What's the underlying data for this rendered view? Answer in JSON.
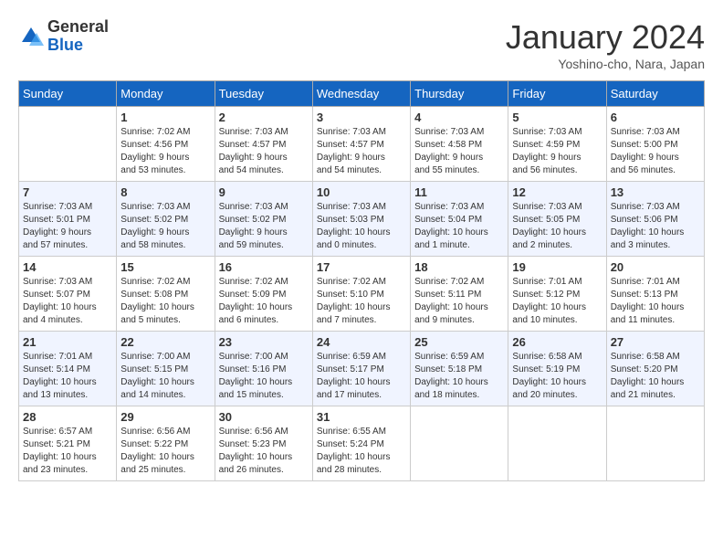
{
  "header": {
    "logo_general": "General",
    "logo_blue": "Blue",
    "title": "January 2024",
    "subtitle": "Yoshino-cho, Nara, Japan"
  },
  "days_of_week": [
    "Sunday",
    "Monday",
    "Tuesday",
    "Wednesday",
    "Thursday",
    "Friday",
    "Saturday"
  ],
  "weeks": [
    [
      {
        "day": "",
        "info": ""
      },
      {
        "day": "1",
        "info": "Sunrise: 7:02 AM\nSunset: 4:56 PM\nDaylight: 9 hours\nand 53 minutes."
      },
      {
        "day": "2",
        "info": "Sunrise: 7:03 AM\nSunset: 4:57 PM\nDaylight: 9 hours\nand 54 minutes."
      },
      {
        "day": "3",
        "info": "Sunrise: 7:03 AM\nSunset: 4:57 PM\nDaylight: 9 hours\nand 54 minutes."
      },
      {
        "day": "4",
        "info": "Sunrise: 7:03 AM\nSunset: 4:58 PM\nDaylight: 9 hours\nand 55 minutes."
      },
      {
        "day": "5",
        "info": "Sunrise: 7:03 AM\nSunset: 4:59 PM\nDaylight: 9 hours\nand 56 minutes."
      },
      {
        "day": "6",
        "info": "Sunrise: 7:03 AM\nSunset: 5:00 PM\nDaylight: 9 hours\nand 56 minutes."
      }
    ],
    [
      {
        "day": "7",
        "info": "Sunrise: 7:03 AM\nSunset: 5:01 PM\nDaylight: 9 hours\nand 57 minutes."
      },
      {
        "day": "8",
        "info": "Sunrise: 7:03 AM\nSunset: 5:02 PM\nDaylight: 9 hours\nand 58 minutes."
      },
      {
        "day": "9",
        "info": "Sunrise: 7:03 AM\nSunset: 5:02 PM\nDaylight: 9 hours\nand 59 minutes."
      },
      {
        "day": "10",
        "info": "Sunrise: 7:03 AM\nSunset: 5:03 PM\nDaylight: 10 hours\nand 0 minutes."
      },
      {
        "day": "11",
        "info": "Sunrise: 7:03 AM\nSunset: 5:04 PM\nDaylight: 10 hours\nand 1 minute."
      },
      {
        "day": "12",
        "info": "Sunrise: 7:03 AM\nSunset: 5:05 PM\nDaylight: 10 hours\nand 2 minutes."
      },
      {
        "day": "13",
        "info": "Sunrise: 7:03 AM\nSunset: 5:06 PM\nDaylight: 10 hours\nand 3 minutes."
      }
    ],
    [
      {
        "day": "14",
        "info": "Sunrise: 7:03 AM\nSunset: 5:07 PM\nDaylight: 10 hours\nand 4 minutes."
      },
      {
        "day": "15",
        "info": "Sunrise: 7:02 AM\nSunset: 5:08 PM\nDaylight: 10 hours\nand 5 minutes."
      },
      {
        "day": "16",
        "info": "Sunrise: 7:02 AM\nSunset: 5:09 PM\nDaylight: 10 hours\nand 6 minutes."
      },
      {
        "day": "17",
        "info": "Sunrise: 7:02 AM\nSunset: 5:10 PM\nDaylight: 10 hours\nand 7 minutes."
      },
      {
        "day": "18",
        "info": "Sunrise: 7:02 AM\nSunset: 5:11 PM\nDaylight: 10 hours\nand 9 minutes."
      },
      {
        "day": "19",
        "info": "Sunrise: 7:01 AM\nSunset: 5:12 PM\nDaylight: 10 hours\nand 10 minutes."
      },
      {
        "day": "20",
        "info": "Sunrise: 7:01 AM\nSunset: 5:13 PM\nDaylight: 10 hours\nand 11 minutes."
      }
    ],
    [
      {
        "day": "21",
        "info": "Sunrise: 7:01 AM\nSunset: 5:14 PM\nDaylight: 10 hours\nand 13 minutes."
      },
      {
        "day": "22",
        "info": "Sunrise: 7:00 AM\nSunset: 5:15 PM\nDaylight: 10 hours\nand 14 minutes."
      },
      {
        "day": "23",
        "info": "Sunrise: 7:00 AM\nSunset: 5:16 PM\nDaylight: 10 hours\nand 15 minutes."
      },
      {
        "day": "24",
        "info": "Sunrise: 6:59 AM\nSunset: 5:17 PM\nDaylight: 10 hours\nand 17 minutes."
      },
      {
        "day": "25",
        "info": "Sunrise: 6:59 AM\nSunset: 5:18 PM\nDaylight: 10 hours\nand 18 minutes."
      },
      {
        "day": "26",
        "info": "Sunrise: 6:58 AM\nSunset: 5:19 PM\nDaylight: 10 hours\nand 20 minutes."
      },
      {
        "day": "27",
        "info": "Sunrise: 6:58 AM\nSunset: 5:20 PM\nDaylight: 10 hours\nand 21 minutes."
      }
    ],
    [
      {
        "day": "28",
        "info": "Sunrise: 6:57 AM\nSunset: 5:21 PM\nDaylight: 10 hours\nand 23 minutes."
      },
      {
        "day": "29",
        "info": "Sunrise: 6:56 AM\nSunset: 5:22 PM\nDaylight: 10 hours\nand 25 minutes."
      },
      {
        "day": "30",
        "info": "Sunrise: 6:56 AM\nSunset: 5:23 PM\nDaylight: 10 hours\nand 26 minutes."
      },
      {
        "day": "31",
        "info": "Sunrise: 6:55 AM\nSunset: 5:24 PM\nDaylight: 10 hours\nand 28 minutes."
      },
      {
        "day": "",
        "info": ""
      },
      {
        "day": "",
        "info": ""
      },
      {
        "day": "",
        "info": ""
      }
    ]
  ]
}
